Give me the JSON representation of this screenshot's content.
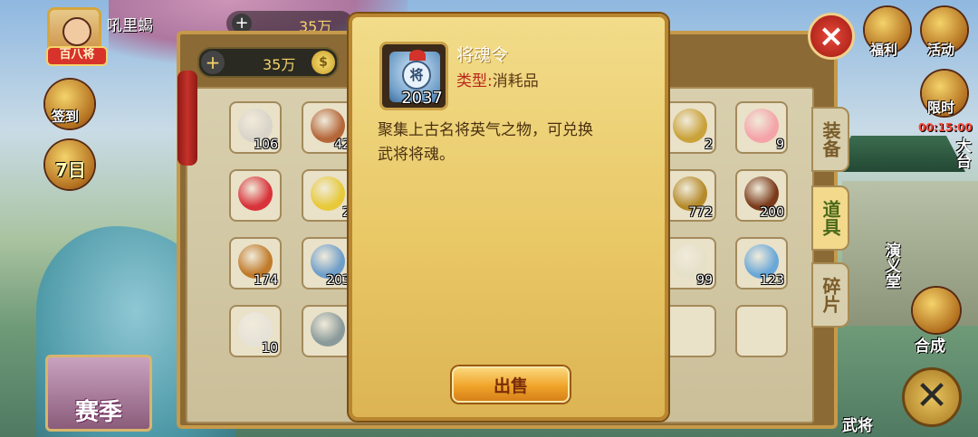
{
  "player": {
    "name": "吼里蝎",
    "rank_badge": "百八将",
    "currency_top": "35万"
  },
  "left_menu": {
    "signin_label": "签到",
    "seven_day_label": "7日",
    "season_label": "赛季"
  },
  "right_menu": {
    "welfare_label": "福利",
    "activity_label": "活动",
    "limited_label": "限时",
    "limited_timer": "00:15:00",
    "platform_label": "大台",
    "hall_label": "演义堂",
    "compose_label": "合成",
    "general_label": "武将"
  },
  "bag": {
    "currency": "35万",
    "coin_symbol": "$",
    "tabs": [
      {
        "label": "装备",
        "active": false
      },
      {
        "label": "道具",
        "active": true
      },
      {
        "label": "碎片",
        "active": false
      }
    ],
    "left_items": [
      {
        "count": "106",
        "color": "#d9d4c9"
      },
      {
        "count": "42",
        "color": "#b5673a"
      },
      {
        "count": "",
        "color": "#d8333a"
      },
      {
        "count": "2",
        "color": "#e7c93a"
      },
      {
        "count": "174",
        "color": "#c07a2a"
      },
      {
        "count": "203",
        "color": "#6f9ec9"
      },
      {
        "count": "10",
        "color": "#e7e2d8"
      },
      {
        "count": "",
        "color": "#8a9a9a"
      }
    ],
    "right_items": [
      {
        "count": "2",
        "color": "#c9a23a"
      },
      {
        "count": "9",
        "color": "#f4a3a8"
      },
      {
        "count": "772",
        "color": "#b58a2a"
      },
      {
        "count": "200",
        "color": "#7a3a1a"
      },
      {
        "count": "99",
        "color": "#e5e0c8"
      },
      {
        "count": "123",
        "color": "#6aa7d8"
      },
      {
        "count": "",
        "color": ""
      },
      {
        "count": "",
        "color": ""
      }
    ]
  },
  "item_popup": {
    "name": "将魂令",
    "type_label": "类型:",
    "type_value": "消耗品",
    "count": "2037",
    "icon_glyph": "将",
    "description_line1": "聚集上古名将英气之物，可兑换",
    "description_line2": "武将将魂。",
    "sell_button": "出售"
  },
  "icons": {
    "close": "×",
    "plus": "+",
    "big_close": "✕"
  }
}
